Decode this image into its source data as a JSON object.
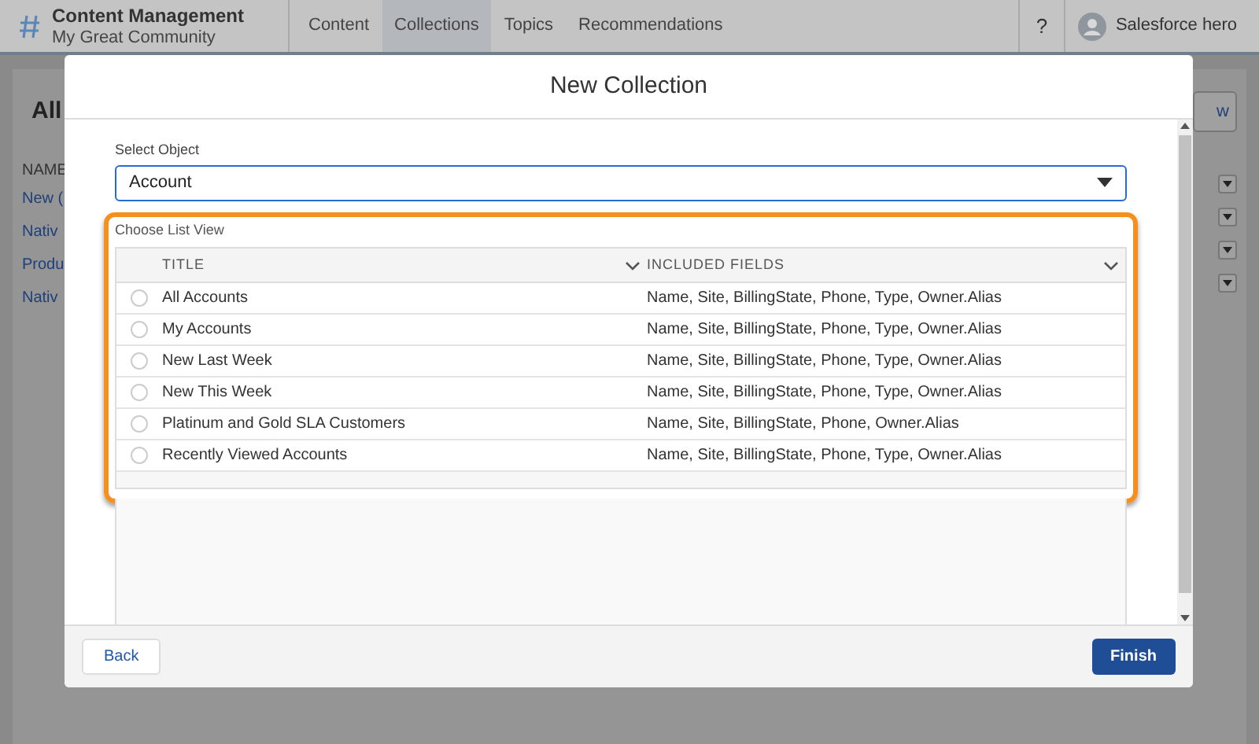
{
  "header": {
    "app_title": "Content Management",
    "community": "My Great Community",
    "nav": [
      {
        "label": "Content",
        "selected": false
      },
      {
        "label": "Collections",
        "selected": true
      },
      {
        "label": "Topics",
        "selected": false
      },
      {
        "label": "Recommendations",
        "selected": false
      }
    ],
    "help": "?",
    "user": "Salesforce hero"
  },
  "background_page": {
    "title": "All",
    "column_1": "NAME",
    "rows": [
      "New (",
      "Nativ",
      "Produ",
      "Nativ"
    ],
    "button": "w"
  },
  "modal": {
    "title": "New Collection",
    "select_object": {
      "label": "Select Object",
      "value": "Account"
    },
    "list_view": {
      "label": "Choose List View",
      "columns": [
        "TITLE",
        "INCLUDED FIELDS"
      ],
      "rows": [
        {
          "title": "All Accounts",
          "fields": "Name, Site, BillingState, Phone, Type, Owner.Alias",
          "selected": false
        },
        {
          "title": "My Accounts",
          "fields": "Name, Site, BillingState, Phone, Type, Owner.Alias",
          "selected": false
        },
        {
          "title": "New Last Week",
          "fields": "Name, Site, BillingState, Phone, Type, Owner.Alias",
          "selected": false
        },
        {
          "title": "New This Week",
          "fields": "Name, Site, BillingState, Phone, Type, Owner.Alias",
          "selected": false
        },
        {
          "title": "Platinum and Gold SLA Customers",
          "fields": "Name, Site, BillingState, Phone, Owner.Alias",
          "selected": false
        },
        {
          "title": "Recently Viewed Accounts",
          "fields": "Name, Site, BillingState, Phone, Type, Owner.Alias",
          "selected": false
        }
      ]
    },
    "buttons": {
      "back": "Back",
      "finish": "Finish"
    }
  }
}
